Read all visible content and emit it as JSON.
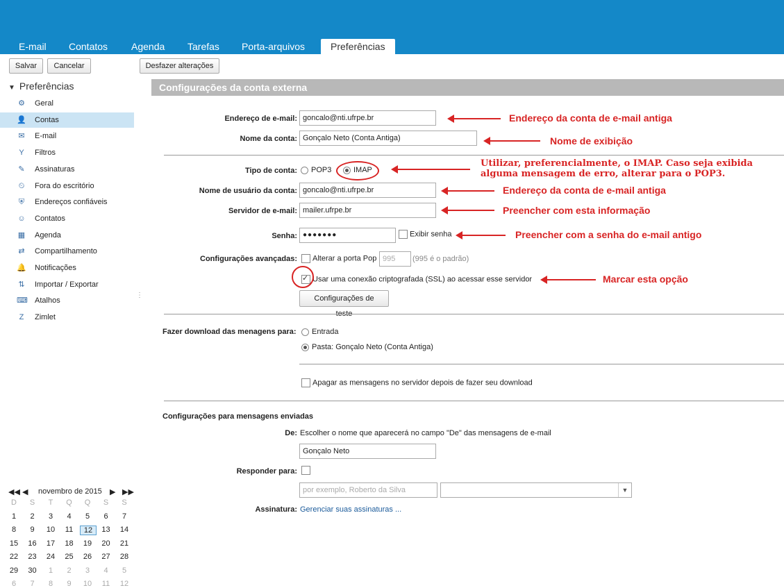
{
  "tabs": [
    "E-mail",
    "Contatos",
    "Agenda",
    "Tarefas",
    "Porta-arquivos",
    "Preferências"
  ],
  "toolbar": {
    "save": "Salvar",
    "cancel": "Cancelar",
    "undo": "Desfazer alterações"
  },
  "sidebar": {
    "header": "Preferências",
    "items": [
      {
        "label": "Geral",
        "icon": "gear-icon"
      },
      {
        "label": "Contas",
        "icon": "accounts-icon"
      },
      {
        "label": "E-mail",
        "icon": "envelope-icon"
      },
      {
        "label": "Filtros",
        "icon": "filter-icon"
      },
      {
        "label": "Assinaturas",
        "icon": "signature-icon"
      },
      {
        "label": "Fora do escritório",
        "icon": "out-of-office-icon"
      },
      {
        "label": "Endereços confiáveis",
        "icon": "shield-icon"
      },
      {
        "label": "Contatos",
        "icon": "contact-icon"
      },
      {
        "label": "Agenda",
        "icon": "calendar-icon"
      },
      {
        "label": "Compartilhamento",
        "icon": "share-icon"
      },
      {
        "label": "Notificações",
        "icon": "bell-icon"
      },
      {
        "label": "Importar / Exportar",
        "icon": "import-export-icon"
      },
      {
        "label": "Atalhos",
        "icon": "keyboard-icon"
      },
      {
        "label": "Zimlet",
        "icon": "zimlet-icon"
      }
    ]
  },
  "calendar": {
    "month_label": "novembro de 2015",
    "weekdays": [
      "D",
      "S",
      "T",
      "Q",
      "Q",
      "S",
      "S"
    ],
    "rows": [
      [
        "1",
        "2",
        "3",
        "4",
        "5",
        "6",
        "7"
      ],
      [
        "8",
        "9",
        "10",
        "11",
        "12",
        "13",
        "14"
      ],
      [
        "15",
        "16",
        "17",
        "18",
        "19",
        "20",
        "21"
      ],
      [
        "22",
        "23",
        "24",
        "25",
        "26",
        "27",
        "28"
      ],
      [
        "29",
        "30",
        "1",
        "2",
        "3",
        "4",
        "5"
      ],
      [
        "6",
        "7",
        "8",
        "9",
        "10",
        "11",
        "12"
      ]
    ],
    "today": "12"
  },
  "form": {
    "section_title": "Configurações da conta externa",
    "email_label": "Endereço de e-mail:",
    "email_value": "goncalo@nti.ufrpe.br",
    "account_name_label": "Nome da conta:",
    "account_name_value": "Gonçalo Neto (Conta Antiga)",
    "account_type_label": "Tipo de conta:",
    "pop3": "POP3",
    "imap": "IMAP",
    "username_label": "Nome de usuário da conta:",
    "username_value": "goncalo@nti.ufrpe.br",
    "server_label": "Servidor de e-mail:",
    "server_value": "mailer.ufrpe.br",
    "password_label": "Senha:",
    "password_value": "●●●●●●●",
    "show_password": "Exibir senha",
    "advanced_label": "Configurações avançadas:",
    "change_port": "Alterar a porta Pop",
    "port_value": "995",
    "port_default": "(995 é o padrão)",
    "ssl_option": "Usar uma conexão criptografada (SSL) ao acessar esse servidor",
    "test_button": "Configurações de teste",
    "download_label": "Fazer download das menagens para:",
    "inbox_option": "Entrada",
    "folder_option": "Pasta: Gonçalo Neto (Conta Antiga)",
    "delete_option": "Apagar as mensagens no servidor depois de fazer seu download",
    "sent_section": "Configurações para mensagens enviadas",
    "from_label": "De:",
    "from_desc": "Escolher o nome que aparecerá no campo \"De\" das mensagens de e-mail",
    "from_value": "Gonçalo Neto",
    "reply_label": "Responder para:",
    "reply_placeholder": "por exemplo, Roberto da Silva",
    "signature_label": "Assinatura:",
    "signature_link": "Gerenciar suas assinaturas ..."
  },
  "annotations": {
    "a1": "Endereço da conta de e-mail antiga",
    "a2": "Nome de exibição",
    "a3_line1": "Utilizar, preferencialmente, o IMAP. Caso seja exibida",
    "a3_line2": "alguma mensagem de erro, alterar para o POP3.",
    "a4": "Endereço da conta de e-mail antiga",
    "a5": "Preencher com esta informação",
    "a6": "Preencher com a senha do e-mail antigo",
    "a7": "Marcar esta opção"
  },
  "colors": {
    "topbar": "#1488c8",
    "annotation": "#d82424",
    "active_nav": "#cbe4f4"
  }
}
